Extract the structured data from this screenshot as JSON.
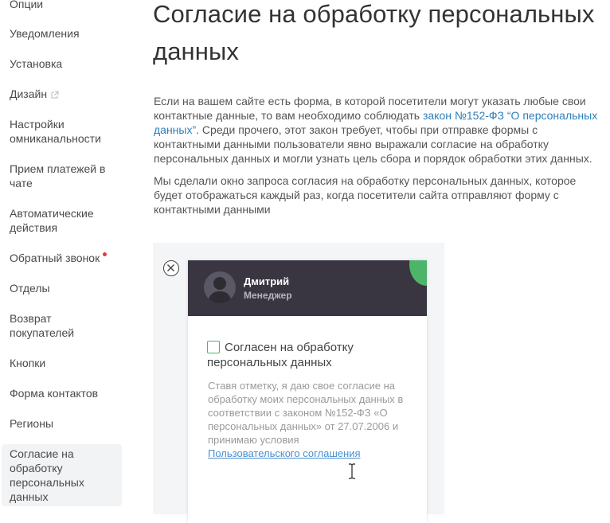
{
  "sidebar": {
    "items": [
      {
        "label": "Опции"
      },
      {
        "label": "Уведомления"
      },
      {
        "label": "Установка"
      },
      {
        "label": "Дизайн",
        "icon": "external-link-icon"
      },
      {
        "label": "Настройки омниканальности"
      },
      {
        "label": "Прием платежей в чате"
      },
      {
        "label": "Автоматические действия"
      },
      {
        "label": "Обратный звонок",
        "badge": "red-dot"
      },
      {
        "label": "Отделы"
      },
      {
        "label": "Возврат покупателей"
      },
      {
        "label": "Кнопки"
      },
      {
        "label": "Форма контактов"
      },
      {
        "label": "Регионы"
      },
      {
        "label": "Согласие на обработку персональных данных",
        "active": true
      }
    ]
  },
  "main": {
    "title": "Согласие на обработку персональных данных",
    "para1_a": "Если на вашем сайте есть форма, в которой посетители могут указать любые свои контактные данные, то вам необходимо соблюдать ",
    "para1_link": "закон №152-ФЗ “О персональных данных”",
    "para1_b": ". Среди прочего, этот закон требует, чтобы при отправке формы с контактными данными пользователи явно выражали согласие на обработку персональных данных и могли узнать цель сбора и порядок обработки этих данных.",
    "para2": "Мы сделали окно запроса согласия на обработку персональных данных, которое будет отображаться каждый раз, когда посетители сайта отправляют форму с контактными данными"
  },
  "widget": {
    "operator_name": "Дмитрий",
    "operator_role": "Менеджер",
    "consent_label": "Согласен на обработку персональных данных",
    "legal_text": "Ставя отметку, я даю свое согласие на обработку моих персональных данных в соответствии с законом №152-ФЗ «О персональных данных» от 27.07.2006 и принимаю условия",
    "legal_link": "Пользовательского соглашения"
  },
  "colors": {
    "accent_link": "#2c7fb8",
    "header_bg": "#393541",
    "green": "#4db56a",
    "red_dot": "#e53935"
  }
}
